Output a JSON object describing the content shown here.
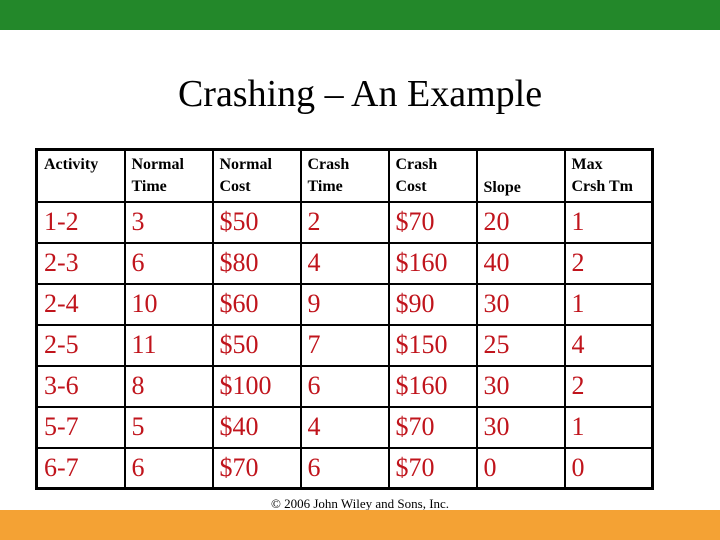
{
  "colors": {
    "top_bar": "#23882a",
    "bottom_bar": "#f4a234",
    "cell_text": "#c0141c"
  },
  "title": "Crashing – An Example",
  "headers": [
    [
      "Activity",
      ""
    ],
    [
      "Normal",
      "Time"
    ],
    [
      "Normal",
      "Cost"
    ],
    [
      "Crash",
      "Time"
    ],
    [
      "Crash",
      "Cost"
    ],
    [
      "",
      "Slope"
    ],
    [
      "Max",
      "Crsh Tm"
    ]
  ],
  "rows": [
    [
      "1-2",
      "3",
      "$50",
      "2",
      "$70",
      "20",
      "1"
    ],
    [
      "2-3",
      "6",
      "$80",
      "4",
      "$160",
      "40",
      "2"
    ],
    [
      "2-4",
      "10",
      "$60",
      "9",
      "$90",
      "30",
      "1"
    ],
    [
      "2-5",
      "11",
      "$50",
      "7",
      "$150",
      "25",
      "4"
    ],
    [
      "3-6",
      "8",
      "$100",
      "6",
      "$160",
      "30",
      "2"
    ],
    [
      "5-7",
      "5",
      "$40",
      "4",
      "$70",
      "30",
      "1"
    ],
    [
      "6-7",
      "6",
      "$70",
      "6",
      "$70",
      "0",
      "0"
    ]
  ],
  "copyright": "© 2006 John Wiley and Sons, Inc."
}
